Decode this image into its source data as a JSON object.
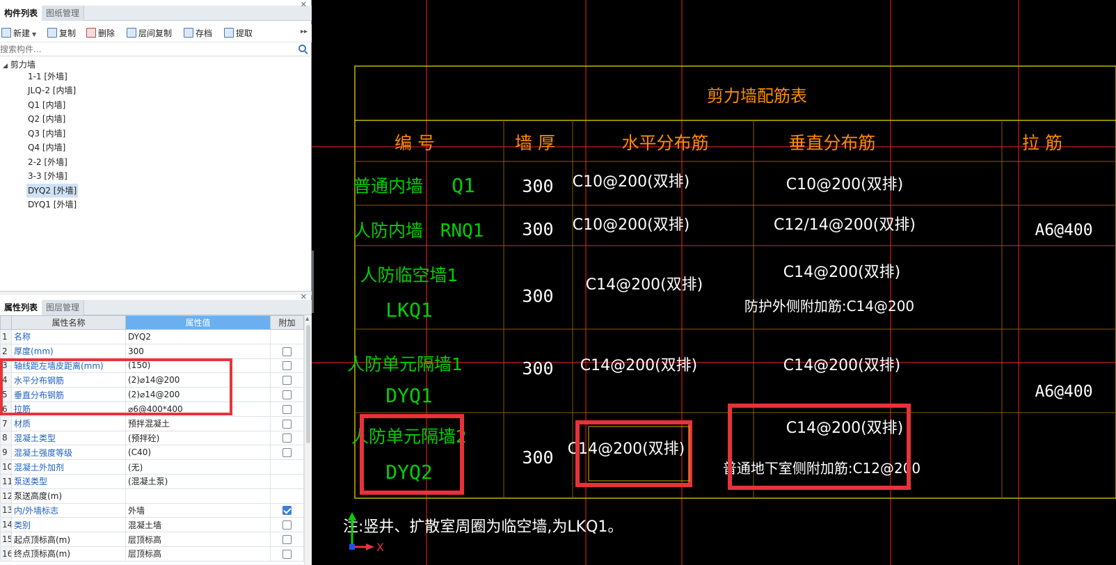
{
  "component_panel": {
    "tabs": [
      "构件列表",
      "图纸管理"
    ],
    "toolbar": {
      "new": "新建",
      "copy": "复制",
      "delete": "删除",
      "floor_copy": "层间复制",
      "archive": "存档",
      "extract": "提取"
    },
    "search_placeholder": "搜索构件...",
    "tree_root": "剪力墙",
    "tree_items": [
      "1-1 [外墙]",
      "JLQ-2 [内墙]",
      "Q1 [内墙]",
      "Q2 [内墙]",
      "Q3 [内墙]",
      "Q4 [内墙]",
      "2-2 [外墙]",
      "3-3 [外墙]",
      "DYQ2 [外墙]",
      "DYQ1 [外墙]"
    ],
    "selected_item": "DYQ2 [外墙]"
  },
  "property_panel": {
    "tabs": [
      "属性列表",
      "图层管理"
    ],
    "headers": {
      "name": "属性名称",
      "value": "属性值",
      "extra": "附加"
    },
    "rows": [
      {
        "no": "1",
        "name": "名称",
        "value": "DYQ2",
        "link": true,
        "check": null
      },
      {
        "no": "2",
        "name": "厚度(mm)",
        "value": "300",
        "link": true,
        "check": false
      },
      {
        "no": "3",
        "name": "轴线距左墙皮距离(mm)",
        "value": "(150)",
        "link": true,
        "check": false
      },
      {
        "no": "4",
        "name": "水平分布钢筋",
        "value": "(2)⌀14@200",
        "link": true,
        "check": false
      },
      {
        "no": "5",
        "name": "垂直分布钢筋",
        "value": "(2)⌀14@200",
        "link": true,
        "check": false
      },
      {
        "no": "6",
        "name": "拉筋",
        "value": "⌀6@400*400",
        "link": true,
        "check": false
      },
      {
        "no": "7",
        "name": "材质",
        "value": "预拌混凝土",
        "link": true,
        "check": false
      },
      {
        "no": "8",
        "name": "混凝土类型",
        "value": "(预拌砼)",
        "link": true,
        "check": false
      },
      {
        "no": "9",
        "name": "混凝土强度等级",
        "value": "(C40)",
        "link": true,
        "check": false
      },
      {
        "no": "10",
        "name": "混凝土外加剂",
        "value": "(无)",
        "link": true,
        "check": null
      },
      {
        "no": "11",
        "name": "泵送类型",
        "value": "(混凝土泵)",
        "link": true,
        "check": null
      },
      {
        "no": "12",
        "name": "泵送高度(m)",
        "value": "",
        "link": false,
        "check": null
      },
      {
        "no": "13",
        "name": "内/外墙标志",
        "value": "外墙",
        "link": true,
        "check": true
      },
      {
        "no": "14",
        "name": "类别",
        "value": "混凝土墙",
        "link": true,
        "check": false
      },
      {
        "no": "15",
        "name": "起点顶标高(m)",
        "value": "层顶标高",
        "link": false,
        "check": false
      },
      {
        "no": "16",
        "name": "终点顶标高(m)",
        "value": "层顶标高",
        "link": false,
        "check": false
      }
    ]
  },
  "cad_table": {
    "title": "剪力墙配筋表",
    "headers": {
      "id": "编 号",
      "thickness": "墙 厚",
      "horizontal": "水平分布筋",
      "vertical": "垂直分布筋",
      "tie": "拉 筋"
    },
    "rows": [
      {
        "name": "普通内墙",
        "code": "Q1",
        "thickness": "300",
        "horizontal": "C10@200(双排)",
        "vertical": "C10@200(双排)",
        "vertical_extra": "",
        "tie": ""
      },
      {
        "name": "人防内墙",
        "code": "RNQ1",
        "thickness": "300",
        "horizontal": "C10@200(双排)",
        "vertical": "C12/14@200(双排)",
        "vertical_extra": "",
        "tie": "A6@400"
      },
      {
        "name": "人防临空墙1",
        "code": "LKQ1",
        "thickness": "300",
        "horizontal": "C14@200(双排)",
        "vertical": "C14@200(双排)",
        "vertical_extra": "防护外侧附加筋:C14@200",
        "tie": ""
      },
      {
        "name": "人防单元隔墙1",
        "code": "DYQ1",
        "thickness": "300",
        "horizontal": "C14@200(双排)",
        "vertical": "C14@200(双排)",
        "vertical_extra": "",
        "tie": "A6@400"
      },
      {
        "name": "人防单元隔墙2",
        "code": "DYQ2",
        "thickness": "300",
        "horizontal": "C14@200(双排)",
        "vertical": "C14@200(双排)",
        "vertical_extra": "普通地下室侧附加筋:C12@200",
        "tie": ""
      }
    ],
    "note": "注:竖井、扩散室周圈为临空墙,为LKQ1。",
    "axis_x_label": "X",
    "colors": {
      "frame": "#c8b400",
      "grid": "#8a5a00",
      "title_text": "#ff8c00",
      "header_text": "#ff8c00",
      "green_text": "#00d000",
      "white_text": "#ffffff",
      "red_line": "#ff2020",
      "highlight": "#e8323a"
    }
  }
}
